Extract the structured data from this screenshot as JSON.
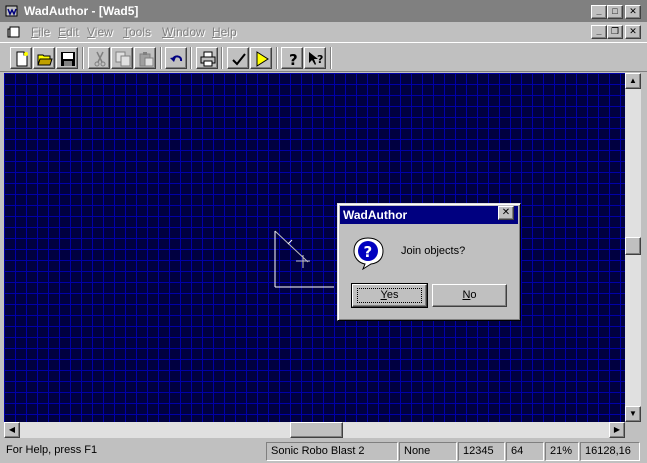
{
  "window": {
    "title": "WadAuthor - [Wad5]"
  },
  "menu": [
    {
      "label": "File",
      "key": "F",
      "rest": "ile"
    },
    {
      "label": "Edit",
      "key": "E",
      "rest": "dit"
    },
    {
      "label": "View",
      "key": "V",
      "rest": "iew"
    },
    {
      "label": "Tools",
      "key": "T",
      "rest": "ools"
    },
    {
      "label": "Window",
      "key": "W",
      "rest": "indow"
    },
    {
      "label": "Help",
      "key": "H",
      "rest": "elp"
    }
  ],
  "toolbar": [
    "new-icon",
    "open-icon",
    "save-icon",
    "cut-icon",
    "copy-icon",
    "paste-icon",
    "undo-icon",
    "print-icon",
    "check-icon",
    "run-icon",
    "help-icon",
    "context-help-icon"
  ],
  "dialog": {
    "title": "WadAuthor",
    "message": "Join objects?",
    "yes_key": "Y",
    "yes_rest": "es",
    "no_key": "N",
    "no_rest": "o"
  },
  "statusbar": {
    "help": "For Help, press F1",
    "game": "Sonic Robo Blast 2",
    "selection": "None",
    "count": "12345",
    "grid": "64",
    "zoom": "21%",
    "coords": "16128,16"
  },
  "colors": {
    "canvas": "#000040",
    "grid": "#0000a8",
    "dialog_title": "#000080"
  }
}
